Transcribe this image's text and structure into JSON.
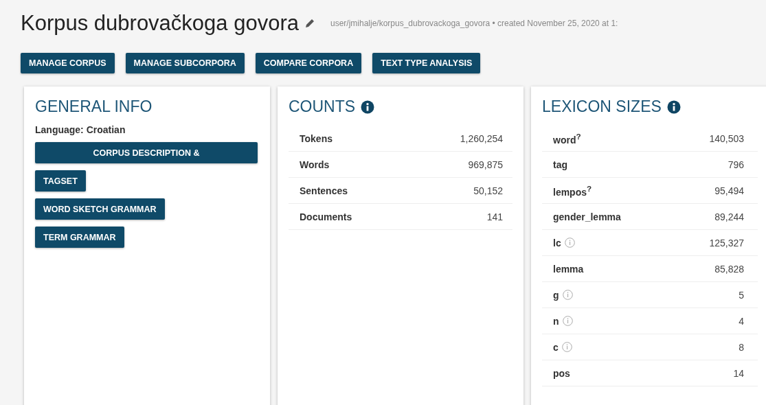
{
  "header": {
    "title": "Korpus dubrovačkoga govora",
    "meta": "user/jmihalje/korpus_dubrovackoga_govora • created November 25, 2020 at 1:"
  },
  "actions": [
    "MANAGE CORPUS",
    "MANAGE SUBCORPORA",
    "COMPARE CORPORA",
    "TEXT TYPE ANALYSIS"
  ],
  "general_info": {
    "heading": "GENERAL INFO",
    "language": "Language: Croatian",
    "buttons": [
      {
        "label": "CORPUS DESCRIPTION &",
        "wide": true
      },
      {
        "label": "TAGSET",
        "wide": false
      },
      {
        "label": "WORD SKETCH GRAMMAR",
        "wide": false
      },
      {
        "label": "TERM GRAMMAR",
        "wide": false
      }
    ]
  },
  "counts": {
    "heading": "COUNTS",
    "rows": [
      {
        "label": "Tokens",
        "value": "1,260,254"
      },
      {
        "label": "Words",
        "value": "969,875"
      },
      {
        "label": "Sentences",
        "value": "50,152"
      },
      {
        "label": "Documents",
        "value": "141"
      }
    ]
  },
  "lexicon_sizes": {
    "heading": "LEXICON SIZES",
    "rows": [
      {
        "label": "word$^{?}$",
        "value": "140,503",
        "info": false
      },
      {
        "label": "tag",
        "value": "796",
        "info": false
      },
      {
        "label": "lempos$^{?}$",
        "value": "95,494",
        "info": false
      },
      {
        "label": "gender_lemma",
        "value": "89,244",
        "info": false
      },
      {
        "label": "lc",
        "value": "125,327",
        "info": true
      },
      {
        "label": "lemma",
        "value": "85,828",
        "info": false
      },
      {
        "label": "g",
        "value": "5",
        "info": true
      },
      {
        "label": "n",
        "value": "4",
        "info": true
      },
      {
        "label": "c",
        "value": "8",
        "info": true
      },
      {
        "label": "pos",
        "value": "14",
        "info": false
      }
    ]
  }
}
